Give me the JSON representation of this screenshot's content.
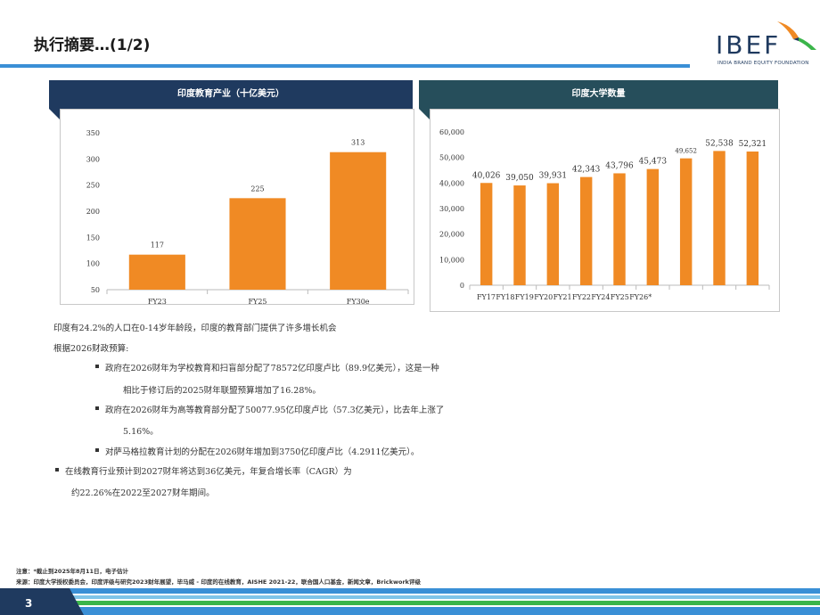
{
  "header": {
    "title": "执行摘要…(1/2)",
    "logo_text": "IBEF",
    "logo_subtitle": "INDIA BRAND EQUITY FOUNDATION"
  },
  "colors": {
    "bar": "#f08a24",
    "header_left": "#1f3a5f",
    "header_right": "#264e5b",
    "accent_blue": "#3a8fd6",
    "footer_green": "#3bb54a",
    "footer_navy": "#1f3a5f"
  },
  "chart_data": [
    {
      "type": "bar",
      "title": "印度教育产业（十亿美元）",
      "categories": [
        "FY23",
        "FY25",
        "FY30e"
      ],
      "values": [
        117,
        225,
        313
      ],
      "data_labels": [
        "117",
        "225",
        "313"
      ],
      "ylim": [
        50,
        350
      ],
      "yticks": [
        "350",
        "300",
        "250",
        "200",
        "150",
        "100",
        "50"
      ],
      "grid": false
    },
    {
      "type": "bar",
      "title": "印度大学数量",
      "categories": [
        "FY17",
        "FY18",
        "FY19",
        "FY20",
        "FY21",
        "FY22",
        "FY24",
        "FY25",
        "FY26*"
      ],
      "values": [
        40026,
        39050,
        39931,
        42343,
        43796,
        45473,
        49652,
        52538,
        52321
      ],
      "data_labels": [
        "40,026",
        "39,050",
        "39,931",
        "42,343",
        "43,796",
        "45,473",
        "49,652",
        "52,538",
        "52,321"
      ],
      "ylim": [
        0,
        60000
      ],
      "yticks": [
        "60,000",
        "50,000",
        "40,000",
        "30,000",
        "20,000",
        "10,000",
        "0"
      ],
      "grid": false
    }
  ],
  "body": {
    "line1": "印度有24.2%的人口在0-14岁年龄段，印度的教育部门提供了许多增长机会",
    "line2": "根据2026财政预算:",
    "b1a": "政府在2026财年为学校教育和扫盲部分配了78572亿印度卢比（89.9亿美元），这是一种",
    "b1b": "相比于修订后的2025财年联盟预算增加了16.28%。",
    "b2a": "政府在2026财年为高等教育部分配了50077.95亿印度卢比（57.3亿美元），比去年上涨了",
    "b2b": "5.16%。",
    "b3": "对萨马格拉教育计划的分配在2026财年增加到3750亿印度卢比（4.2911亿美元）。",
    "b4a": "在线教育行业预计到2027财年将达到36亿美元，年复合增长率（CAGR）为",
    "b4b": "约22.26%在2022至2027财年期间。"
  },
  "footer": {
    "note": "注意：*截止到2025年8月11日，电子估计",
    "source": "来源：印度大学授权委员会，印度评级与研究2023财年展望，毕马威 - 印度的在线教育，AISHE 2021-22，联合国人口基金，新闻文章，Brickwork评级",
    "page": "3"
  }
}
